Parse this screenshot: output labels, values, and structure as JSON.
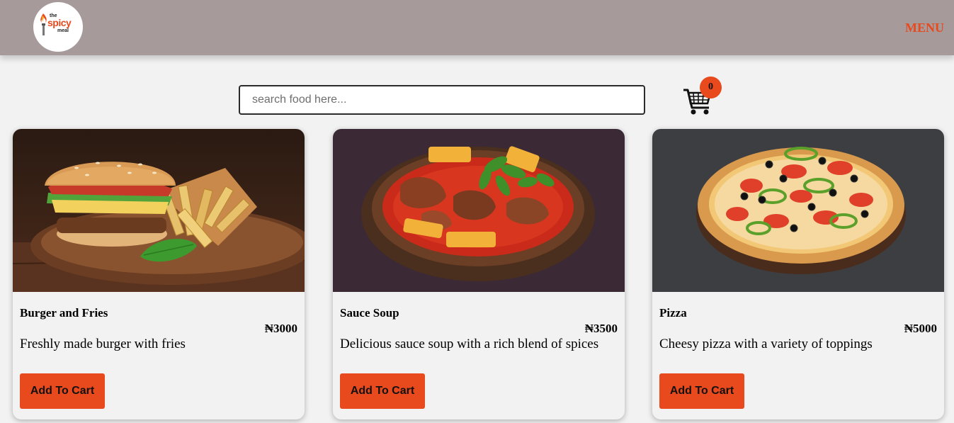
{
  "brand": {
    "logo_line1": "the",
    "logo_line2": "spicy",
    "logo_line3": "meal"
  },
  "nav": {
    "menu_label": "MENU"
  },
  "search": {
    "placeholder": "search food here...",
    "value": ""
  },
  "cart": {
    "count": "0",
    "icon": "shopping-cart-icon"
  },
  "colors": {
    "accent": "#e8491d",
    "navbar": "#a69a9a",
    "background": "#f2f2f2"
  },
  "products": [
    {
      "name": "Burger and Fries",
      "price": "₦3000",
      "description": "Freshly made burger with fries",
      "button_label": "Add To Cart"
    },
    {
      "name": "Sauce Soup",
      "price": "₦3500",
      "description": "Delicious sauce soup with a rich blend of spices",
      "button_label": "Add To Cart"
    },
    {
      "name": "Pizza",
      "price": "₦5000",
      "description": "Cheesy pizza with a variety of toppings",
      "button_label": "Add To Cart"
    }
  ]
}
